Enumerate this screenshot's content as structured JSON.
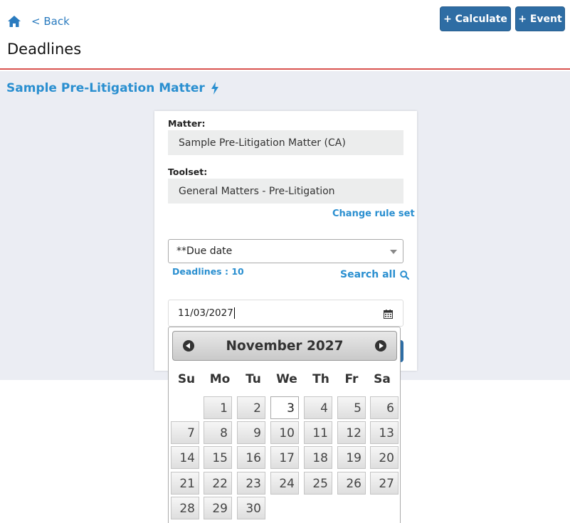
{
  "header": {
    "back_label": "< Back",
    "title": "Deadlines",
    "calculate_label": "+ Calculate",
    "event_label": "+ Event"
  },
  "matter_link": "Sample Pre-Litigation Matter",
  "form": {
    "matter_label": "Matter:",
    "matter_value": "Sample Pre-Litigation Matter (CA)",
    "toolset_label": "Toolset:",
    "toolset_value": "General Matters - Pre-Litigation",
    "change_rule_set": "Change rule set",
    "event_select": "**Due date",
    "deadlines_count": "Deadlines : 10",
    "search_all": "Search all",
    "date_value": "11/03/2027"
  },
  "calendar": {
    "month_title": "November 2027",
    "weekdays": [
      "Su",
      "Mo",
      "Tu",
      "We",
      "Th",
      "Fr",
      "Sa"
    ],
    "first_weekday": 1,
    "days_in_month": 30,
    "selected_day": 3
  },
  "colors": {
    "primary": "#2e6da4",
    "link": "#2a8fd0",
    "divider": "#d9534f",
    "background": "#ebedf3"
  }
}
